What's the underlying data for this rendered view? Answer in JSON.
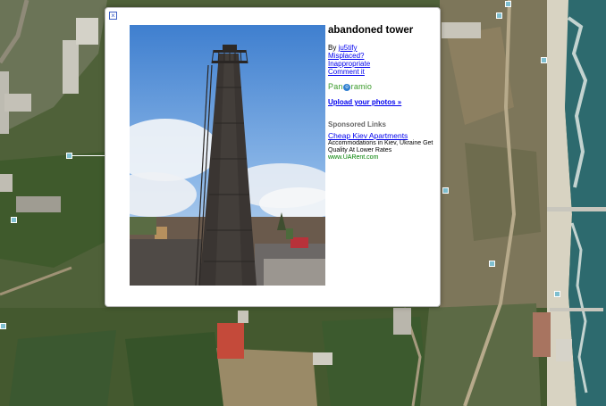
{
  "map": {
    "colors": {
      "vegetation": "#3f5a2c",
      "ground": "#8c7f60",
      "sea": "#2d6a6e",
      "foam": "#e9eee9",
      "roof": "#c44a3a"
    }
  },
  "popup": {
    "close_icon": "close-icon",
    "title": "abandoned tower",
    "by_prefix": "By",
    "author": "ju5tify",
    "links": [
      "Misplaced?",
      "Inappropriate",
      "Comment it"
    ],
    "brand": {
      "before": "Pan",
      "o": "o",
      "after": "ramio"
    },
    "upload_label": "Upload your photos »",
    "sponsored": {
      "heading": "Sponsored Links",
      "ad_title": "Cheap Kiev Apartments",
      "ad_text": "Accommodations in Kiev, Ukraine Get Quality At Lower Rates",
      "ad_url": "www.UARent.com"
    }
  }
}
